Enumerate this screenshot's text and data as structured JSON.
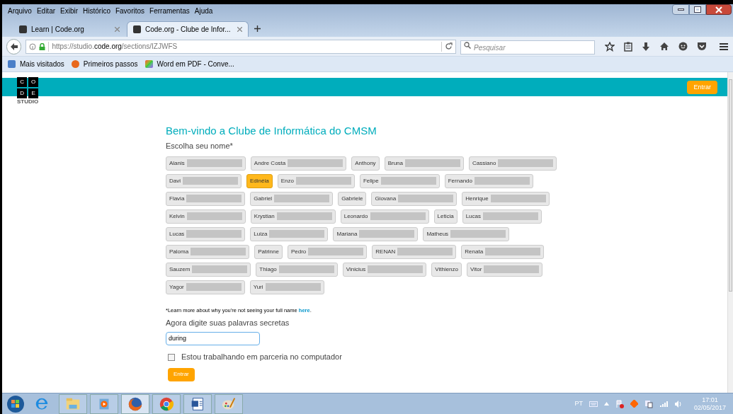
{
  "menu": [
    "Arquivo",
    "Editar",
    "Exibir",
    "Histórico",
    "Favoritos",
    "Ferramentas",
    "Ajuda"
  ],
  "tabs": [
    {
      "label": "Learn | Code.org",
      "selected": false
    },
    {
      "label": "Code.org - Clube de Infor...",
      "selected": true
    }
  ],
  "address": {
    "prefix": "https://studio.",
    "host": "code.org",
    "path": "/sections/IZJWFS"
  },
  "search": {
    "placeholder": "Pesquisar"
  },
  "bookmarks": [
    "Mais visitados",
    "Primeiros passos",
    "Word em PDF - Conve..."
  ],
  "header": {
    "logo_letters": [
      "C",
      "O",
      "D",
      "E"
    ],
    "logo_caption": "STUDIO",
    "signin": "Entrar"
  },
  "title": "Bem-vindo a Clube de Informática do CMSM",
  "choose_label": "Escolha seu nome*",
  "name_rows": [
    [
      {
        "name": "Alanis",
        "surname_hidden": true,
        "selected": false
      },
      {
        "name": "Andre Costa",
        "surname_hidden": true,
        "selected": false
      },
      {
        "name": "Anthony",
        "surname_hidden": false,
        "selected": false
      },
      {
        "name": "Bruna",
        "surname_hidden": true,
        "selected": false
      },
      {
        "name": "Cassiano",
        "surname_hidden": true,
        "selected": false
      }
    ],
    [
      {
        "name": "Davi",
        "surname_hidden": true,
        "selected": false
      },
      {
        "name": "Edinéia",
        "surname_hidden": false,
        "selected": true
      },
      {
        "name": "Enzo",
        "surname_hidden": true,
        "selected": false
      },
      {
        "name": "Felipe",
        "surname_hidden": true,
        "selected": false
      },
      {
        "name": "Fernando",
        "surname_hidden": true,
        "selected": false
      }
    ],
    [
      {
        "name": "Flavia",
        "surname_hidden": true,
        "selected": false
      },
      {
        "name": "Gabriel",
        "surname_hidden": true,
        "selected": false
      },
      {
        "name": "Gabriele",
        "surname_hidden": false,
        "selected": false
      },
      {
        "name": "Giovana",
        "surname_hidden": true,
        "selected": false
      },
      {
        "name": "Henrique",
        "surname_hidden": true,
        "selected": false
      }
    ],
    [
      {
        "name": "Kelvin",
        "surname_hidden": true,
        "selected": false
      },
      {
        "name": "Krystian",
        "surname_hidden": true,
        "selected": false
      },
      {
        "name": "Leonardo",
        "surname_hidden": true,
        "selected": false
      },
      {
        "name": "Leticia",
        "surname_hidden": false,
        "selected": false
      },
      {
        "name": "Lucas",
        "surname_hidden": true,
        "selected": false
      }
    ],
    [
      {
        "name": "Lucas",
        "surname_hidden": true,
        "selected": false
      },
      {
        "name": "Luiza",
        "surname_hidden": true,
        "selected": false
      },
      {
        "name": "Mariana",
        "surname_hidden": true,
        "selected": false
      },
      {
        "name": "Matheus",
        "surname_hidden": true,
        "selected": false
      }
    ],
    [
      {
        "name": "Paloma",
        "surname_hidden": true,
        "selected": false
      },
      {
        "name": "Patrinne",
        "surname_hidden": false,
        "selected": false
      },
      {
        "name": "Pedro",
        "surname_hidden": true,
        "selected": false
      },
      {
        "name": "RENAN",
        "surname_hidden": true,
        "selected": false
      },
      {
        "name": "Renata",
        "surname_hidden": true,
        "selected": false
      }
    ],
    [
      {
        "name": "Sauzem",
        "surname_hidden": true,
        "selected": false
      },
      {
        "name": "Thiago",
        "surname_hidden": true,
        "selected": false
      },
      {
        "name": "Vinicius",
        "surname_hidden": true,
        "selected": false
      },
      {
        "name": "Vithienzo",
        "surname_hidden": false,
        "selected": false
      },
      {
        "name": "Vitor",
        "surname_hidden": true,
        "selected": false
      }
    ],
    [
      {
        "name": "Yagor",
        "surname_hidden": true,
        "selected": false
      },
      {
        "name": "Yuri",
        "surname_hidden": true,
        "selected": false
      }
    ]
  ],
  "footnote": {
    "text": "*Learn more about why you're not seeing your full name",
    "link": "here",
    "end": "."
  },
  "secret_label": "Agora digite suas palavras secretas",
  "secret_field": {
    "value": "during"
  },
  "pair": {
    "label": "Estou trabalhando em parceria no computador",
    "checked": false
  },
  "submit": "Entrar",
  "tray": {
    "language": "PT",
    "time": "17:01",
    "date": "02/05/2017"
  }
}
